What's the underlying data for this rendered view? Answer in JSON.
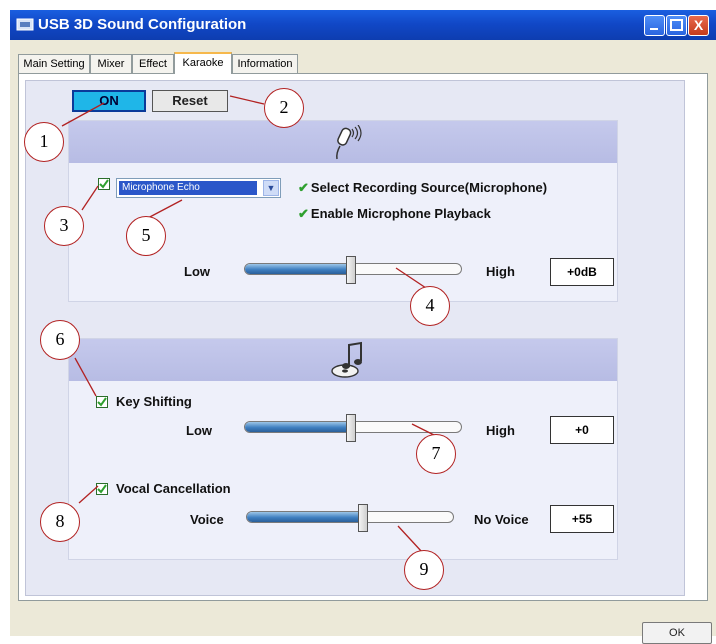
{
  "window": {
    "title": "USB 3D Sound Configuration",
    "close_glyph": "X"
  },
  "tabs": [
    "Main Setting",
    "Mixer",
    "Effect",
    "Karaoke",
    "Information"
  ],
  "active_tab": "Karaoke",
  "toolbar": {
    "on_label": "ON",
    "reset_label": "Reset"
  },
  "mic_section": {
    "icon": "microphone-icon",
    "enabled": true,
    "effect_select": "Microphone Echo",
    "status_lines": [
      "Select Recording Source(Microphone)",
      "Enable Microphone Playback"
    ],
    "slider": {
      "low_label": "Low",
      "high_label": "High",
      "value_text": "+0dB",
      "level": 0.5
    }
  },
  "music_section": {
    "icon": "music-disc-icon",
    "key_shifting": {
      "label": "Key Shifting",
      "checked": true,
      "low_label": "Low",
      "high_label": "High",
      "value_text": "+0",
      "level": 0.5
    },
    "vocal_cancellation": {
      "label": "Vocal Cancellation",
      "checked": true,
      "low_label": "Voice",
      "high_label": "No Voice",
      "value_text": "+55",
      "level": 0.55
    }
  },
  "callouts": [
    "1",
    "2",
    "3",
    "4",
    "5",
    "6",
    "7",
    "8",
    "9"
  ],
  "footer": {
    "ok_label": "OK"
  },
  "colors": {
    "title_bar": "#1148c7",
    "on_button": "#1fb6e8",
    "callout_ring": "#b22222",
    "check_green": "#2fa02f"
  }
}
